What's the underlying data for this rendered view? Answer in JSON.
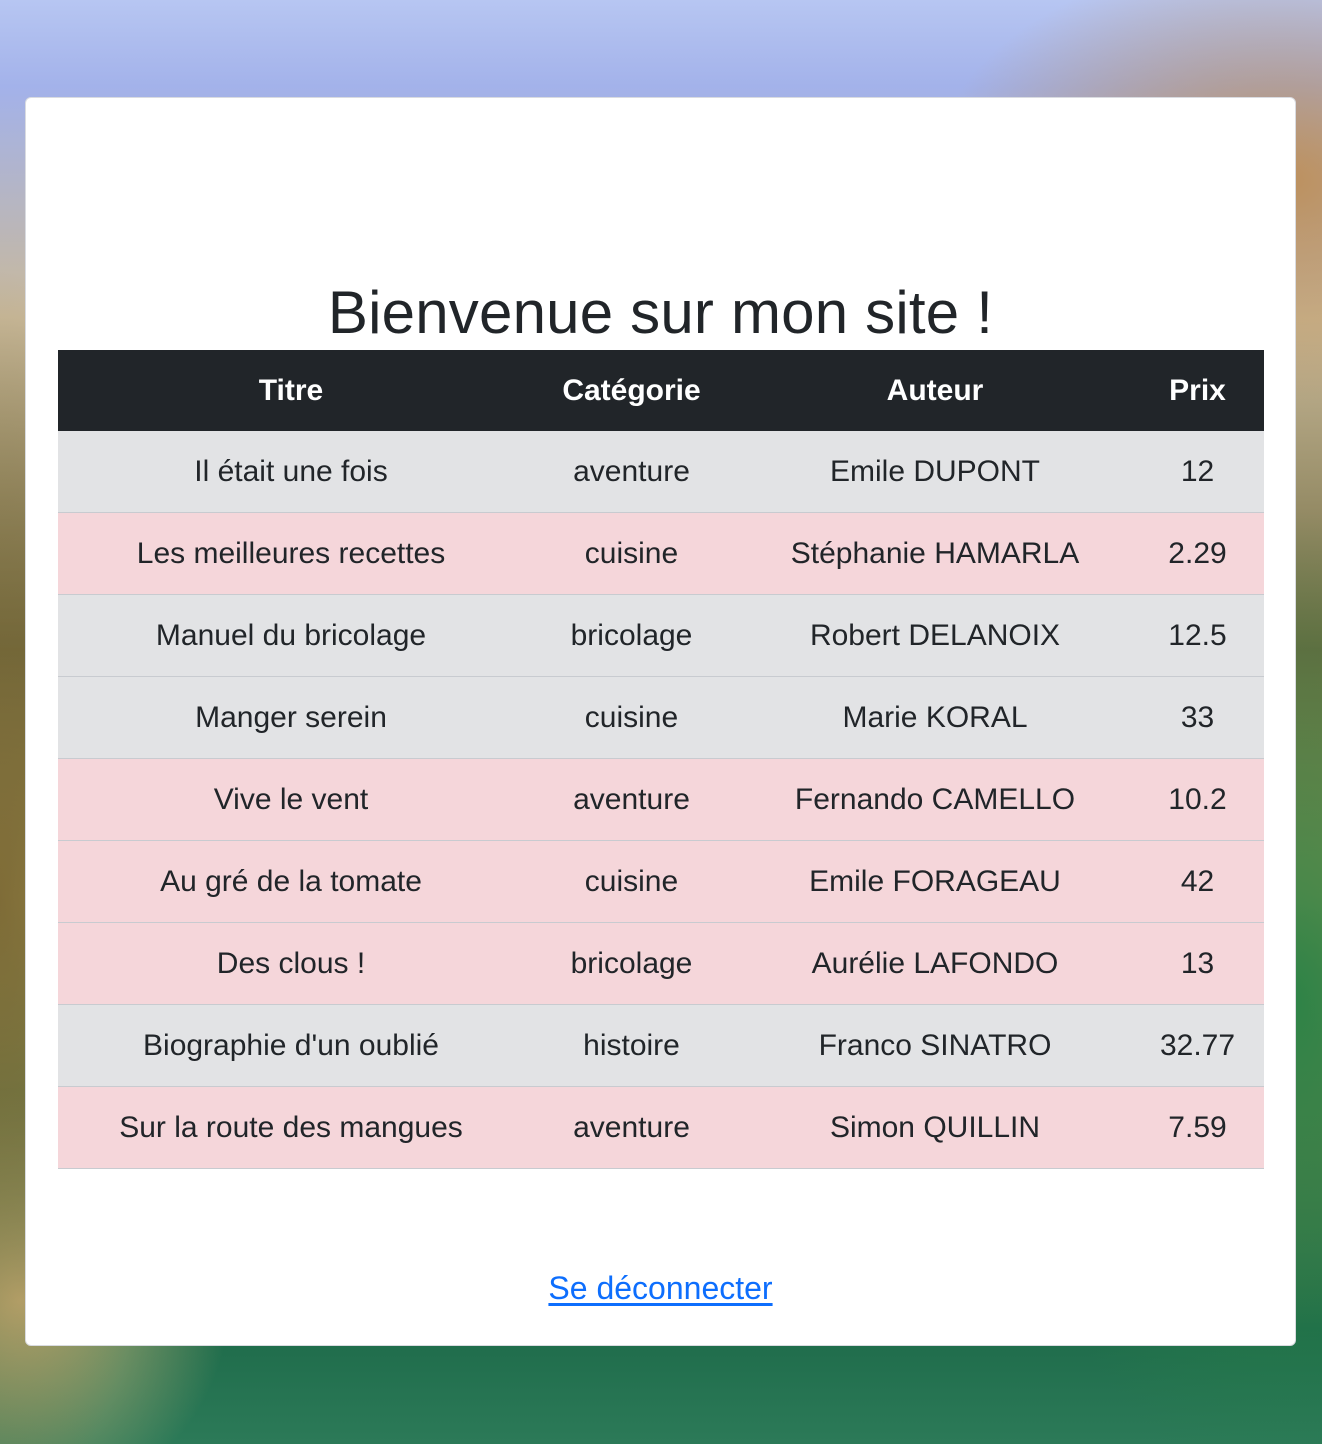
{
  "page": {
    "title": "Bienvenue sur mon site !",
    "logout_label": "Se déconnecter"
  },
  "table": {
    "headers": [
      "Titre",
      "Catégorie",
      "Auteur",
      "Prix"
    ],
    "rows": [
      {
        "titre": "Il était une fois",
        "categorie": "aventure",
        "auteur": "Emile DUPONT",
        "prix": "12",
        "row_color": "#e2e3e5"
      },
      {
        "titre": "Les meilleures recettes",
        "categorie": "cuisine",
        "auteur": "Stéphanie HAMARLA",
        "prix": "2.29",
        "row_color": "#f5d6da"
      },
      {
        "titre": "Manuel du bricolage",
        "categorie": "bricolage",
        "auteur": "Robert DELANOIX",
        "prix": "12.5",
        "row_color": "#e2e3e5"
      },
      {
        "titre": "Manger serein",
        "categorie": "cuisine",
        "auteur": "Marie KORAL",
        "prix": "33",
        "row_color": "#e2e3e5"
      },
      {
        "titre": "Vive le vent",
        "categorie": "aventure",
        "auteur": "Fernando CAMELLO",
        "prix": "10.2",
        "row_color": "#f5d6da"
      },
      {
        "titre": "Au gré de la tomate",
        "categorie": "cuisine",
        "auteur": "Emile FORAGEAU",
        "prix": "42",
        "row_color": "#f5d6da"
      },
      {
        "titre": "Des clous !",
        "categorie": "bricolage",
        "auteur": "Aurélie LAFONDO",
        "prix": "13",
        "row_color": "#f5d6da"
      },
      {
        "titre": "Biographie d'un oublié",
        "categorie": "histoire",
        "auteur": "Franco SINATRO",
        "prix": "32.77",
        "row_color": "#e2e3e5"
      },
      {
        "titre": "Sur la route des mangues",
        "categorie": "aventure",
        "auteur": "Simon QUILLIN",
        "prix": "7.59",
        "row_color": "#f5d6da"
      }
    ]
  },
  "colors": {
    "header_bg": "#212529",
    "row_grey": "#e2e3e5",
    "row_pink": "#f5d6da",
    "link": "#0d6efd"
  }
}
